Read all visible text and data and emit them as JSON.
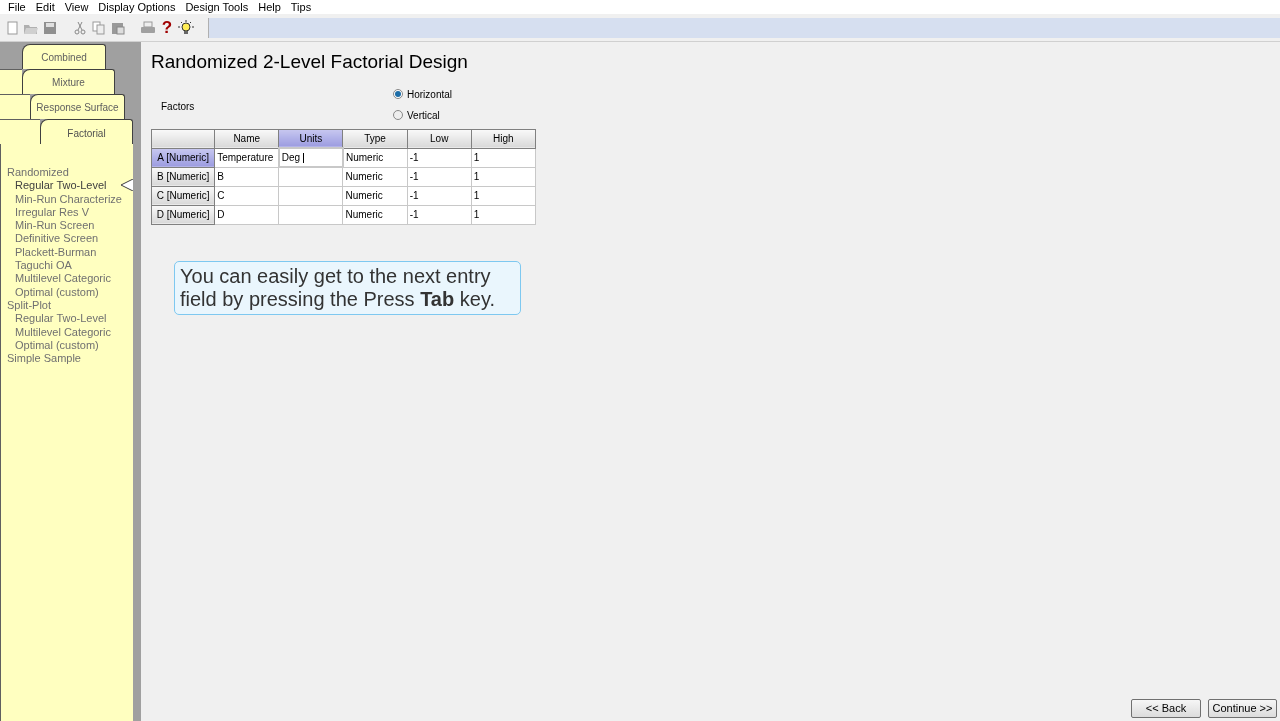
{
  "menu": [
    "File",
    "Edit",
    "View",
    "Display Options",
    "Design Tools",
    "Help",
    "Tips"
  ],
  "toolbar": [
    {
      "kind": "new"
    },
    {
      "kind": "open"
    },
    {
      "kind": "save"
    },
    {
      "kind": "sep"
    },
    {
      "kind": "cut"
    },
    {
      "kind": "copy"
    },
    {
      "kind": "paste"
    },
    {
      "kind": "sep"
    },
    {
      "kind": "print"
    },
    {
      "kind": "help",
      "label": "?"
    },
    {
      "kind": "tip"
    }
  ],
  "tabs": [
    {
      "label": "Combined",
      "selected": false
    },
    {
      "label": "Mixture",
      "selected": false
    },
    {
      "label": "Response Surface",
      "selected": false
    },
    {
      "label": "Factorial",
      "selected": true
    }
  ],
  "tree": [
    {
      "label": "Randomized",
      "selected": false,
      "children": [
        {
          "label": "Regular Two-Level",
          "selected": true
        },
        {
          "label": "Min-Run Characterize",
          "selected": false
        },
        {
          "label": "Irregular Res V",
          "selected": false
        },
        {
          "label": "Min-Run Screen",
          "selected": false
        },
        {
          "label": "Definitive Screen",
          "selected": false
        },
        {
          "label": "Plackett-Burman",
          "selected": false
        },
        {
          "label": "Taguchi OA",
          "selected": false
        },
        {
          "label": "Multilevel Categoric",
          "selected": false
        },
        {
          "label": "Optimal (custom)",
          "selected": false
        }
      ]
    },
    {
      "label": "Split-Plot",
      "selected": false,
      "children": [
        {
          "label": "Regular Two-Level",
          "selected": false
        },
        {
          "label": "Multilevel Categoric",
          "selected": false
        },
        {
          "label": "Optimal (custom)",
          "selected": false
        }
      ]
    },
    {
      "label": "Simple Sample",
      "selected": false
    }
  ],
  "title": "Randomized 2-Level Factorial Design",
  "factors_label": "Factors",
  "orientation": [
    {
      "label": "Horizontal",
      "selected": true
    },
    {
      "label": "Vertical",
      "selected": false
    }
  ],
  "table": {
    "columns": [
      {
        "label": "Name",
        "selected": false
      },
      {
        "label": "Units",
        "selected": true
      },
      {
        "label": "Type",
        "selected": false
      },
      {
        "label": "Low",
        "selected": false
      },
      {
        "label": "High",
        "selected": false
      }
    ],
    "rows": [
      {
        "header": "A [Numeric]",
        "selected": true,
        "cells": [
          "Temperature",
          "Deg",
          "Numeric",
          "-1",
          "1"
        ],
        "editing": true
      },
      {
        "header": "B [Numeric]",
        "selected": false,
        "editing": false,
        "cells": [
          "B",
          "",
          "Numeric",
          "-1",
          "1"
        ]
      },
      {
        "header": "C [Numeric]",
        "selected": false,
        "editing": false,
        "cells": [
          "C",
          "",
          "Numeric",
          "-1",
          "1"
        ]
      },
      {
        "header": "D [Numeric]",
        "selected": false,
        "editing": false,
        "cells": [
          "D",
          "",
          "Numeric",
          "-1",
          "1"
        ]
      }
    ]
  },
  "tip": "You can easily get to the next entry field by pressing the Press **Tab** key.",
  "buttons": [
    "<< Back",
    "Continue >>"
  ]
}
